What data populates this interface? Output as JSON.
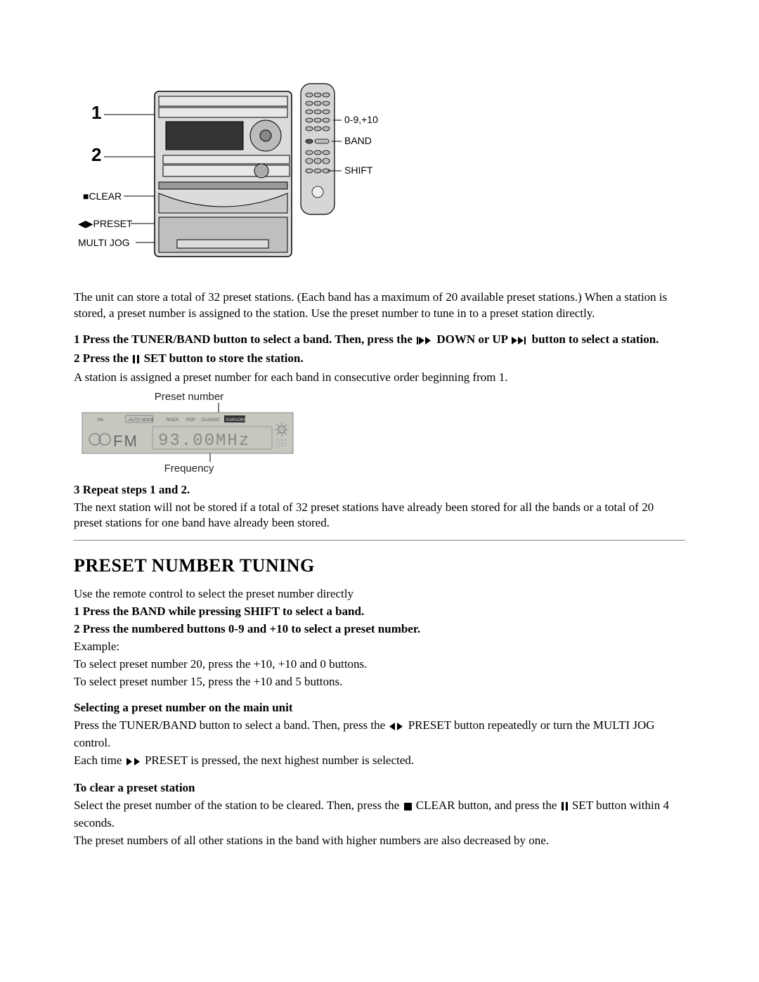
{
  "diagram": {
    "labels_left": [
      "1",
      "2",
      "■CLEAR",
      "◀▶PRESET",
      "MULTI JOG"
    ],
    "labels_right": [
      "0-9,+10",
      "BAND",
      "SHIFT"
    ]
  },
  "intro": "The unit can store a total of 32 preset stations. (Each band has a maximum of 20 available preset stations.)  When a station is stored, a preset number is assigned to the station. Use the preset number to tune in to a preset station directly.",
  "step1a": "1 Press the TUNER/BAND button to select a band.  Then, press the  ",
  "step1b": " DOWN or UP ",
  "step1c": "  button to select a station.",
  "step2a": "2 Press the ",
  "step2b": " SET button to store the station.",
  "step2_body": "A station is assigned a preset number for each band in consecutive order beginning from 1.",
  "lcd_top_label": "Preset number",
  "lcd_bottom_label": "Frequency",
  "lcd_band": "FM",
  "lcd_value": "93.00MHz",
  "lcd_tags": [
    "AUTO MODE",
    "ROCK",
    "POP",
    "CLASSIC",
    "KARAOKE"
  ],
  "step3_head": "3 Repeat steps 1 and 2.",
  "step3_body": "The next station will not be stored if a total of 32 preset stations have already been stored for all the bands or a total of 20 preset stations for one band have already been stored.",
  "h_preset": "PRESET NUMBER TUNING",
  "remote_intro": "Use the remote control to select the preset number directly",
  "remote_step1": "1 Press the BAND while pressing SHIFT to select a band.",
  "remote_step2": "2 Press the numbered buttons 0-9 and +10 to select a preset number.",
  "example_label": "Example:",
  "example_1": "To select preset number 20, press the +10, +10 and 0 buttons.",
  "example_2": "To select preset number 15, press the +10 and 5 buttons.",
  "main_unit_head": "Selecting a preset number on the main unit",
  "main_unit_1a": "Press the TUNER/BAND button to select a band. Then, press the ",
  "main_unit_1b": " PRESET button repeatedly or turn the MULTI JOG control.",
  "main_unit_2a": "Each time ",
  "main_unit_2b": " PRESET is pressed, the next highest number is selected.",
  "clear_head": "To clear a preset station",
  "clear_1a": "Select the preset number of the station to be cleared. Then, press the ",
  "clear_1b": " CLEAR button, and press the ",
  "clear_1c": " SET button within 4 seconds.",
  "clear_2": "The preset numbers of all other stations in the band with higher numbers are also decreased by one."
}
